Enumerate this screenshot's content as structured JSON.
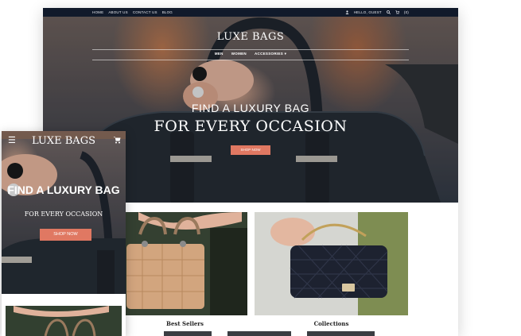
{
  "desktop": {
    "topbar": {
      "nav": [
        "HOME",
        "ABOUT US",
        "CONTACT US",
        "BLOG"
      ],
      "account_label": "HELLO, GUEST",
      "cart_count": "(0)"
    },
    "brand": "LUXE BAGS",
    "main_nav": [
      "MEN",
      "WOMEN",
      "ACCESSORIES ▾"
    ],
    "hero": {
      "line1": "FIND A LUXURY BAG",
      "line2": "FOR EVERY OCCASION",
      "button_label": "SHOP NOW"
    },
    "tiles": [
      {
        "caption": "Best Sellers"
      },
      {
        "caption": "Collections"
      }
    ]
  },
  "mobile": {
    "brand": "LUXE BAGS",
    "menu_icon": "hamburger-icon",
    "cart_icon": "cart-icon",
    "hero": {
      "line1": "FIND A LUXURY BAG",
      "line2": "FOR EVERY OCCASION",
      "button_label": "SHOP NOW"
    }
  },
  "colors": {
    "topbar_bg": "#111a2b",
    "accent": "#e07862",
    "text_dark": "#222222"
  }
}
